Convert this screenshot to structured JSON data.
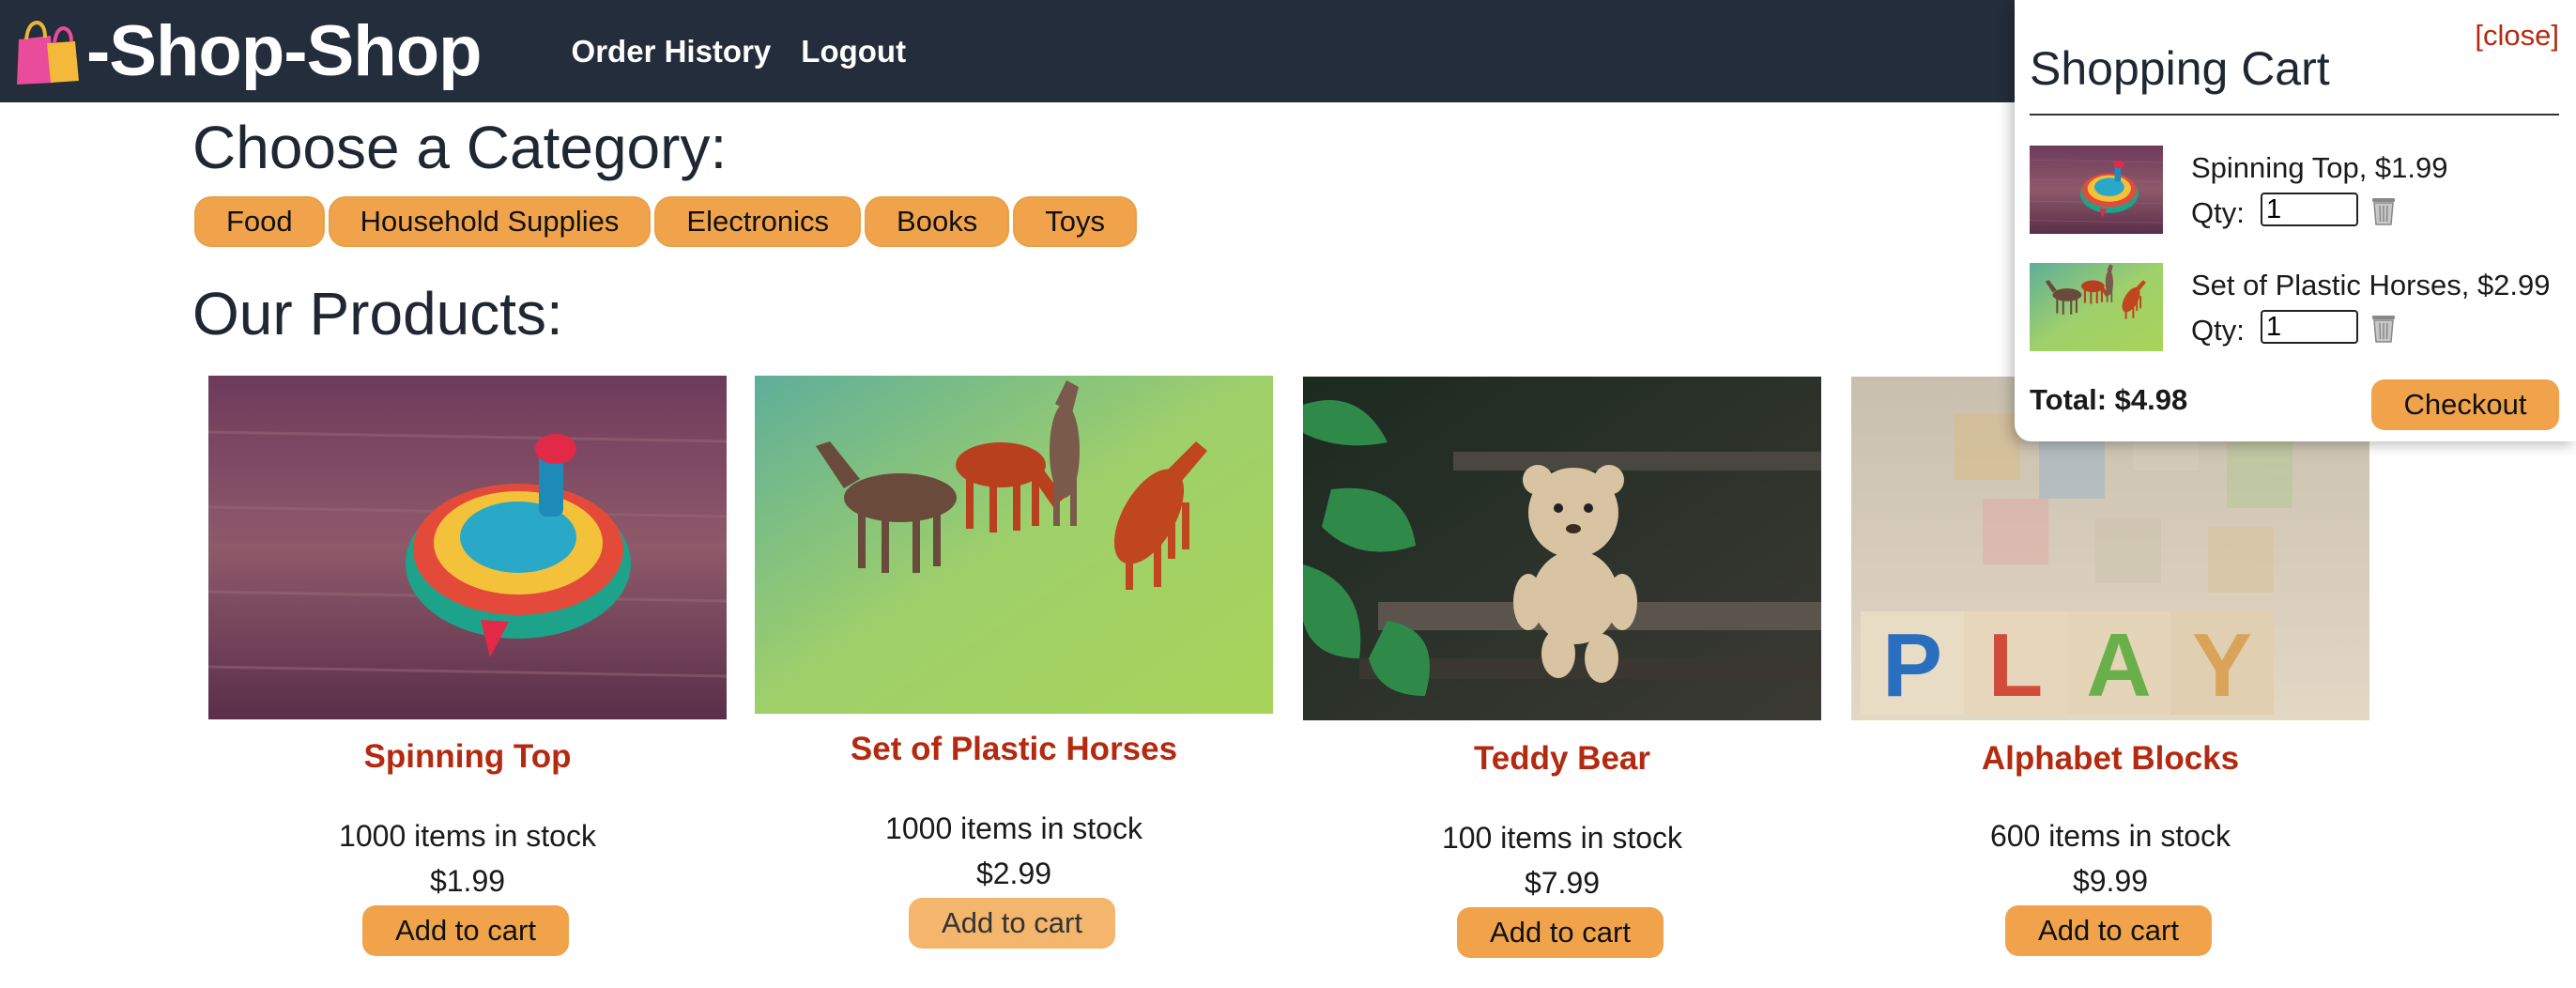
{
  "header": {
    "brand": "-Shop-Shop",
    "brand_icon": "shopping-bags-icon",
    "nav": [
      {
        "label": "Order History"
      },
      {
        "label": "Logout"
      }
    ]
  },
  "categories": {
    "heading": "Choose a Category:",
    "items": [
      "Food",
      "Household Supplies",
      "Electronics",
      "Books",
      "Toys"
    ]
  },
  "products": {
    "heading": "Our Products:",
    "items": [
      {
        "name": "Spinning Top",
        "stock": "1000 items in stock",
        "price": "$1.99",
        "button": "Add to cart"
      },
      {
        "name": "Set of Plastic Horses",
        "stock": "1000 items in stock",
        "price": "$2.99",
        "button": "Add to cart"
      },
      {
        "name": "Teddy Bear",
        "stock": "100 items in stock",
        "price": "$7.99",
        "button": "Add to cart"
      },
      {
        "name": "Alphabet Blocks",
        "stock": "600 items in stock",
        "price": "$9.99",
        "button": "Add to cart"
      }
    ]
  },
  "cart": {
    "close": "[close]",
    "title": "Shopping Cart",
    "items": [
      {
        "label": "Spinning Top, $1.99",
        "qty_label": "Qty:",
        "qty": "1"
      },
      {
        "label": "Set of Plastic Horses, $2.99",
        "qty_label": "Qty:",
        "qty": "1"
      }
    ],
    "total": "Total: $4.98",
    "checkout": "Checkout"
  },
  "colors": {
    "header_bg": "#232d3b",
    "accent": "#f0a34b",
    "product_name": "#b42a10"
  }
}
